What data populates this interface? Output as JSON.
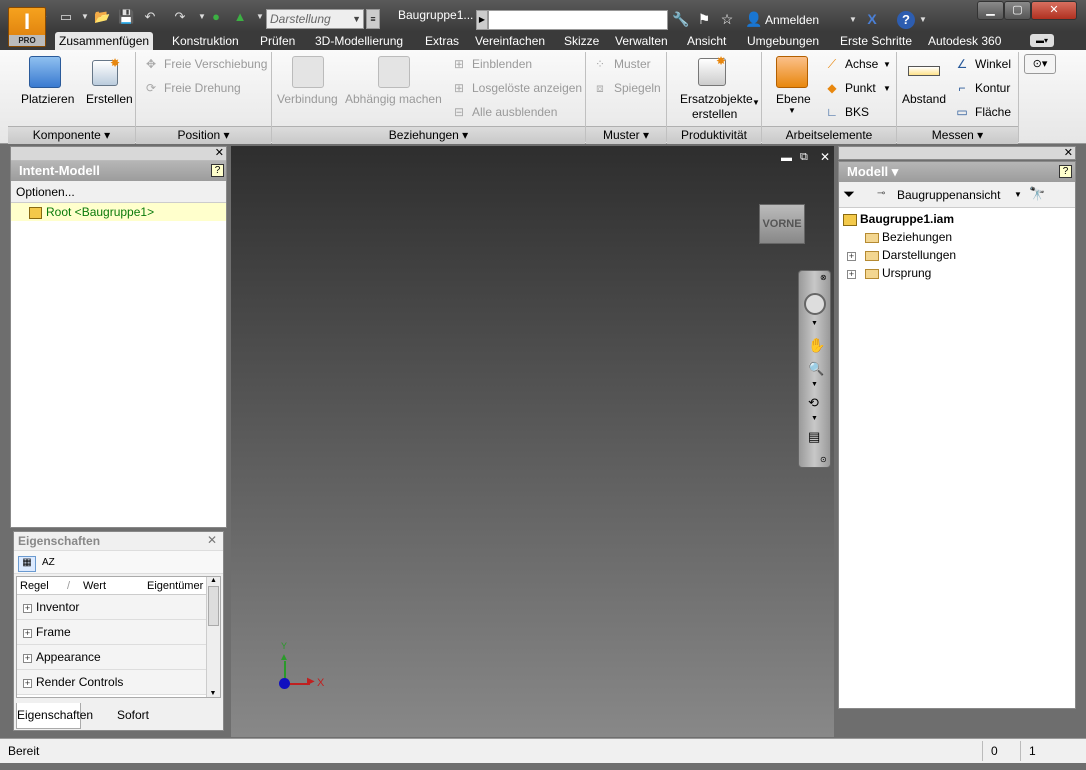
{
  "app": {
    "logo_letter": "I",
    "logo_edition": "PRO",
    "file_title": "Baugruppe1...",
    "representation": "Darstellung",
    "sign_in": "Anmelden"
  },
  "tabs": [
    {
      "label": "Zusammenfügen"
    },
    {
      "label": "Konstruktion"
    },
    {
      "label": "Prüfen"
    },
    {
      "label": "3D-Modellierung"
    },
    {
      "label": "Extras"
    },
    {
      "label": "Vereinfachen"
    },
    {
      "label": "Skizze"
    },
    {
      "label": "Verwalten"
    },
    {
      "label": "Ansicht"
    },
    {
      "label": "Umgebungen"
    },
    {
      "label": "Erste Schritte"
    },
    {
      "label": "Autodesk 360"
    }
  ],
  "ribbon": {
    "komponente": {
      "title": "Komponente",
      "platzieren": "Platzieren",
      "erstellen": "Erstellen"
    },
    "position": {
      "title": "Position",
      "freie_verschiebung": "Freie Verschiebung",
      "freie_drehung": "Freie Drehung"
    },
    "beziehungen": {
      "title": "Beziehungen",
      "verbindung": "Verbindung",
      "abhaengig": "Abhängig machen",
      "einblenden": "Einblenden",
      "losgeloeste": "Losgelöste anzeigen",
      "alle_ausblenden": "Alle ausblenden"
    },
    "muster": {
      "title": "Muster",
      "muster": "Muster",
      "spiegeln": "Spiegeln"
    },
    "produktivitaet": {
      "title": "Produktivität",
      "ersatz1": "Ersatzobjekte",
      "ersatz2": "erstellen"
    },
    "arbeitselemente": {
      "title": "Arbeitselemente",
      "ebene": "Ebene",
      "achse": "Achse",
      "punkt": "Punkt",
      "bks": "BKS"
    },
    "messen": {
      "title": "Messen",
      "abstand": "Abstand",
      "winkel": "Winkel",
      "kontur": "Kontur",
      "flaeche": "Fläche"
    }
  },
  "intent": {
    "title": "Intent-Modell",
    "options": "Optionen...",
    "root": "Root <Baugruppe1>"
  },
  "properties": {
    "title": "Eigenschaften",
    "col_regel": "Regel",
    "col_wert": "Wert",
    "col_eigentuemer": "Eigentümer",
    "rows": [
      "Inventor",
      "Frame",
      "Appearance",
      "Render Controls"
    ],
    "tab_eigenschaften": "Eigenschaften",
    "tab_sofort": "Sofort"
  },
  "viewport": {
    "viewcube": "VORNE",
    "axis_x": "X",
    "axis_y": "Y"
  },
  "model": {
    "title": "Modell",
    "view_dropdown": "Baugruppenansicht",
    "root": "Baugruppe1.iam",
    "items": [
      "Beziehungen",
      "Darstellungen",
      "Ursprung"
    ]
  },
  "status": {
    "text": "Bereit",
    "count1": "0",
    "count2": "1"
  },
  "colors": {
    "accent_orange": "#e8870e",
    "tab_active": "#e8e8e8"
  }
}
